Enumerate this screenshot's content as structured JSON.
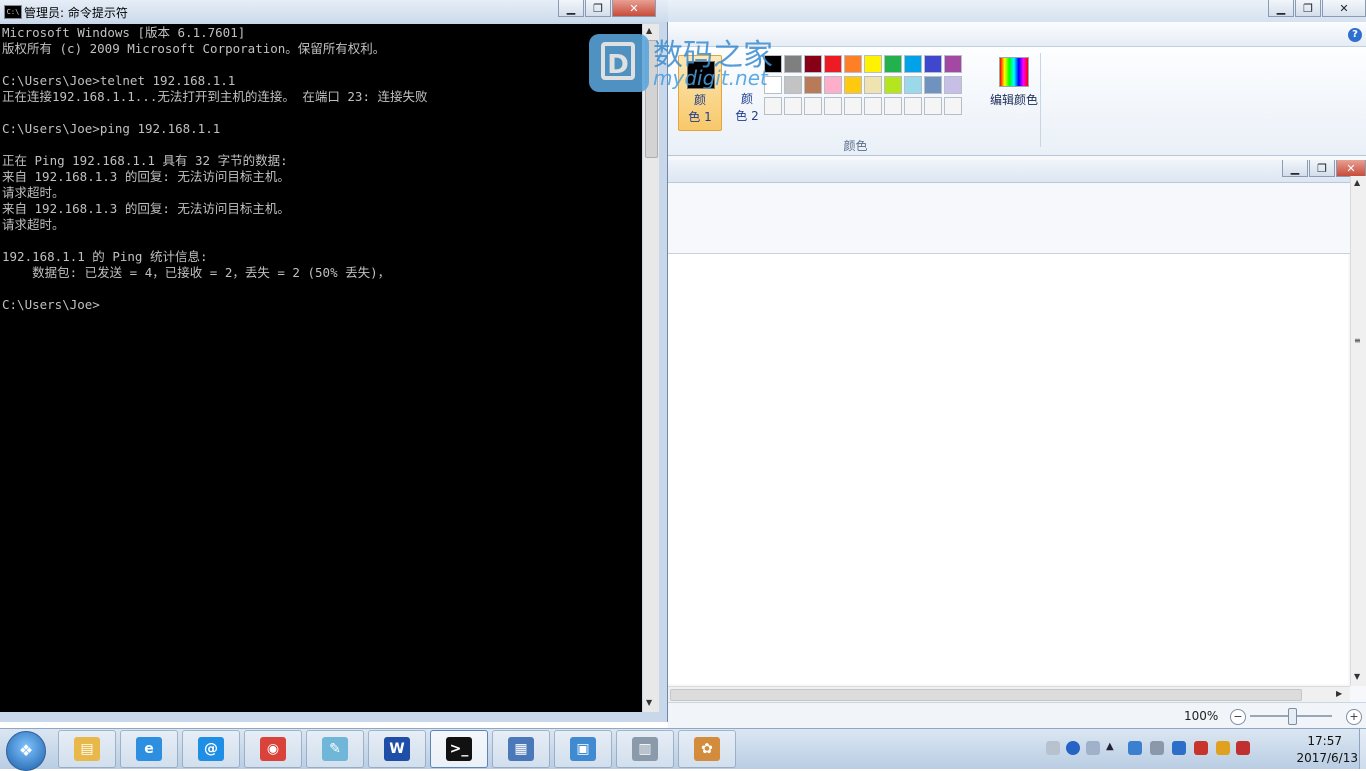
{
  "cmd": {
    "title": "管理员: 命令提示符",
    "icon": "cmd-icon",
    "lines": [
      "Microsoft Windows [版本 6.1.7601]",
      "版权所有 (c) 2009 Microsoft Corporation。保留所有权利。",
      "",
      "C:\\Users\\Joe>telnet 192.168.1.1",
      "正在连接192.168.1.1...无法打开到主机的连接。 在端口 23: 连接失败",
      "",
      "C:\\Users\\Joe>ping 192.168.1.1",
      "",
      "正在 Ping 192.168.1.1 具有 32 字节的数据:",
      "来自 192.168.1.3 的回复: 无法访问目标主机。",
      "请求超时。",
      "来自 192.168.1.3 的回复: 无法访问目标主机。",
      "请求超时。",
      "",
      "192.168.1.1 的 Ping 统计信息:",
      "    数据包: 已发送 = 4，已接收 = 2，丢失 = 2 (50% 丢失)，",
      "",
      "C:\\Users\\Joe>"
    ]
  },
  "watermark": {
    "cn": "数码之家",
    "en": "mydigit.net",
    "logo_letter": "D"
  },
  "paint": {
    "color1_label_a": "颜",
    "color1_label_b": "色 1",
    "color2_label_a": "颜",
    "color2_label_b": "色 2",
    "edit_colors": "编辑颜色",
    "group_label": "颜色",
    "palette_row1": [
      "#000000",
      "#7f7f7f",
      "#880015",
      "#ed1c24",
      "#ff7f27",
      "#fff200",
      "#22b14c",
      "#00a2e8",
      "#3f48cc",
      "#a349a4"
    ],
    "palette_row2": [
      "#ffffff",
      "#c3c3c3",
      "#b97a57",
      "#ffaec9",
      "#ffc90e",
      "#efe4b0",
      "#b5e61d",
      "#99d9ea",
      "#7092be",
      "#c8bfe7"
    ],
    "palette_row3": [
      "#f5f5f5",
      "#f5f5f5",
      "#f5f5f5",
      "#f5f5f5",
      "#f5f5f5",
      "#f5f5f5",
      "#f5f5f5",
      "#f5f5f5",
      "#f5f5f5",
      "#f5f5f5"
    ],
    "zoom": "100%",
    "zoom_out": "−",
    "zoom_in": "+"
  },
  "help_glyph": "?",
  "taskbar": {
    "start_glyph": "❖",
    "apps": [
      {
        "name": "file-explorer",
        "color": "#e8b84a",
        "glyph": "▤"
      },
      {
        "name": "internet-explorer",
        "color": "#2d8fe0",
        "glyph": "e"
      },
      {
        "name": "baidu-app",
        "color": "#1f8fe5",
        "glyph": "@"
      },
      {
        "name": "chrome",
        "color": "#d9433a",
        "glyph": "◉"
      },
      {
        "name": "notepad",
        "color": "#6fb6d8",
        "glyph": "✎"
      },
      {
        "name": "word",
        "color": "#1f4ea8",
        "glyph": "W"
      },
      {
        "name": "command-prompt",
        "color": "#111111",
        "glyph": ">_"
      },
      {
        "name": "network-tool",
        "color": "#4a78b8",
        "glyph": "▦"
      },
      {
        "name": "remote-desktop",
        "color": "#3f8ad0",
        "glyph": "▣"
      },
      {
        "name": "installer",
        "color": "#8a9aab",
        "glyph": "▥"
      },
      {
        "name": "paint",
        "color": "#d28c3c",
        "glyph": "✿"
      }
    ],
    "time": "17:57",
    "date": "2017/6/13"
  }
}
